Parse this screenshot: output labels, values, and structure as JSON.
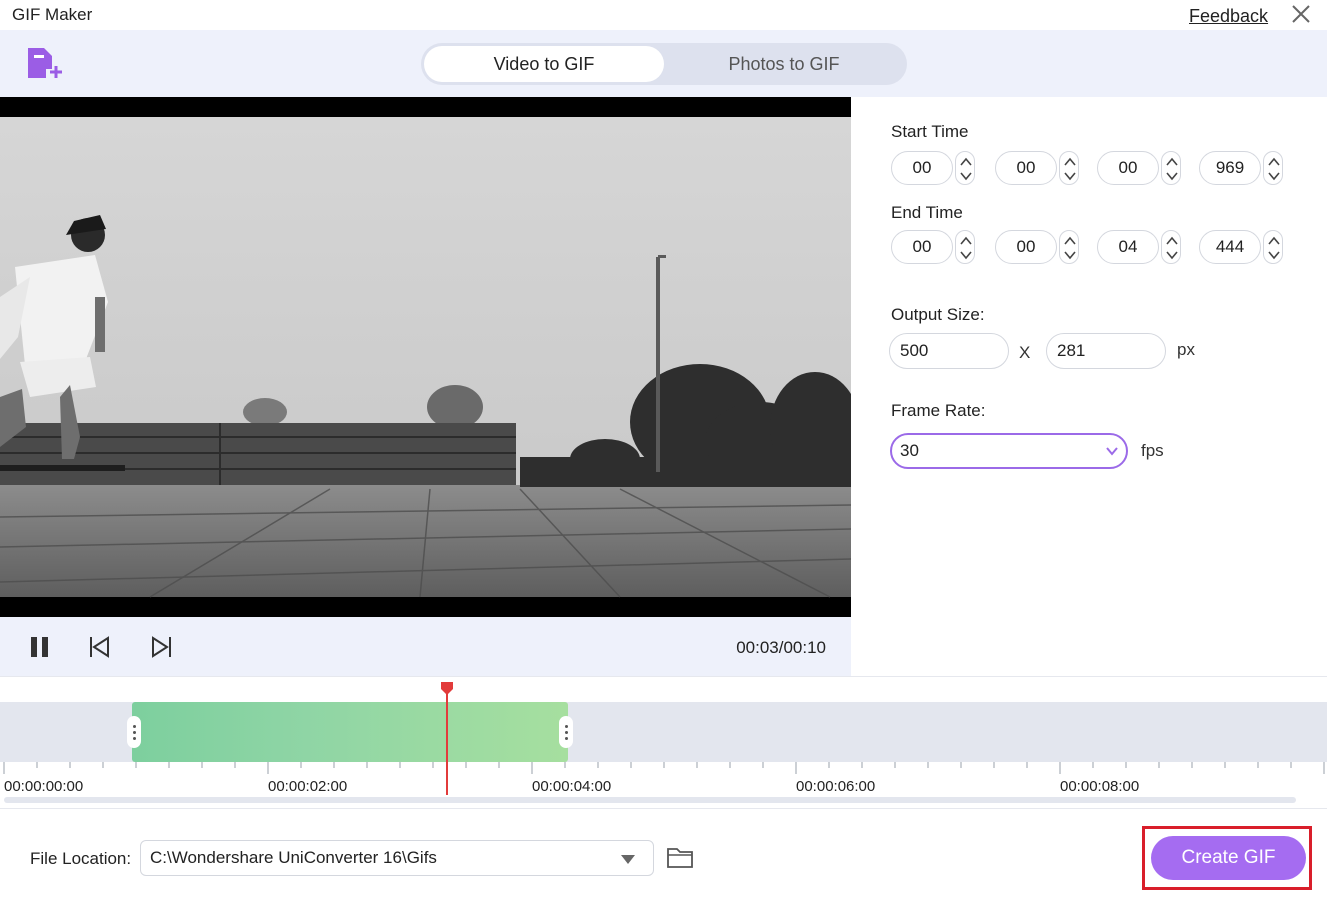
{
  "window": {
    "title": "GIF Maker",
    "feedback_link": "Feedback",
    "close_icon": "close-icon"
  },
  "toolbar": {
    "add_file_icon": "add-file-icon"
  },
  "mode_tabs": {
    "active": "Video to GIF",
    "inactive": "Photos to GIF"
  },
  "player": {
    "time": "00:03/00:10",
    "pause_icon": "pause-icon",
    "prev_frame_icon": "previous-frame-icon",
    "next_frame_icon": "next-frame-icon"
  },
  "settings": {
    "start_time": {
      "label": "Start Time",
      "hours": "00",
      "minutes": "00",
      "seconds": "00",
      "ms": "969"
    },
    "end_time": {
      "label": "End Time",
      "hours": "00",
      "minutes": "00",
      "seconds": "04",
      "ms": "444"
    },
    "output_size": {
      "label": "Output Size:",
      "width": "500",
      "separator": "X",
      "height": "281",
      "unit": "px"
    },
    "frame_rate": {
      "label": "Frame Rate:",
      "value": "30",
      "unit": "fps"
    }
  },
  "timeline": {
    "ticks": [
      "00:00:00:00",
      "00:00:02:00",
      "00:00:04:00",
      "00:00:06:00",
      "00:00:08:00"
    ],
    "playhead_seconds": 3.0,
    "clip_start_seconds": 0.969,
    "clip_end_seconds": 4.444
  },
  "file_location": {
    "label": "File Location:",
    "path": "C:\\Wondershare UniConverter 16\\Gifs",
    "folder_icon": "folder-icon"
  },
  "actions": {
    "create_gif": "Create GIF"
  },
  "colors": {
    "accent": "#a56cf1",
    "highlight_box": "#d91e2a",
    "clip_green": "#8fd5a5",
    "playhead": "#e23b3b"
  }
}
